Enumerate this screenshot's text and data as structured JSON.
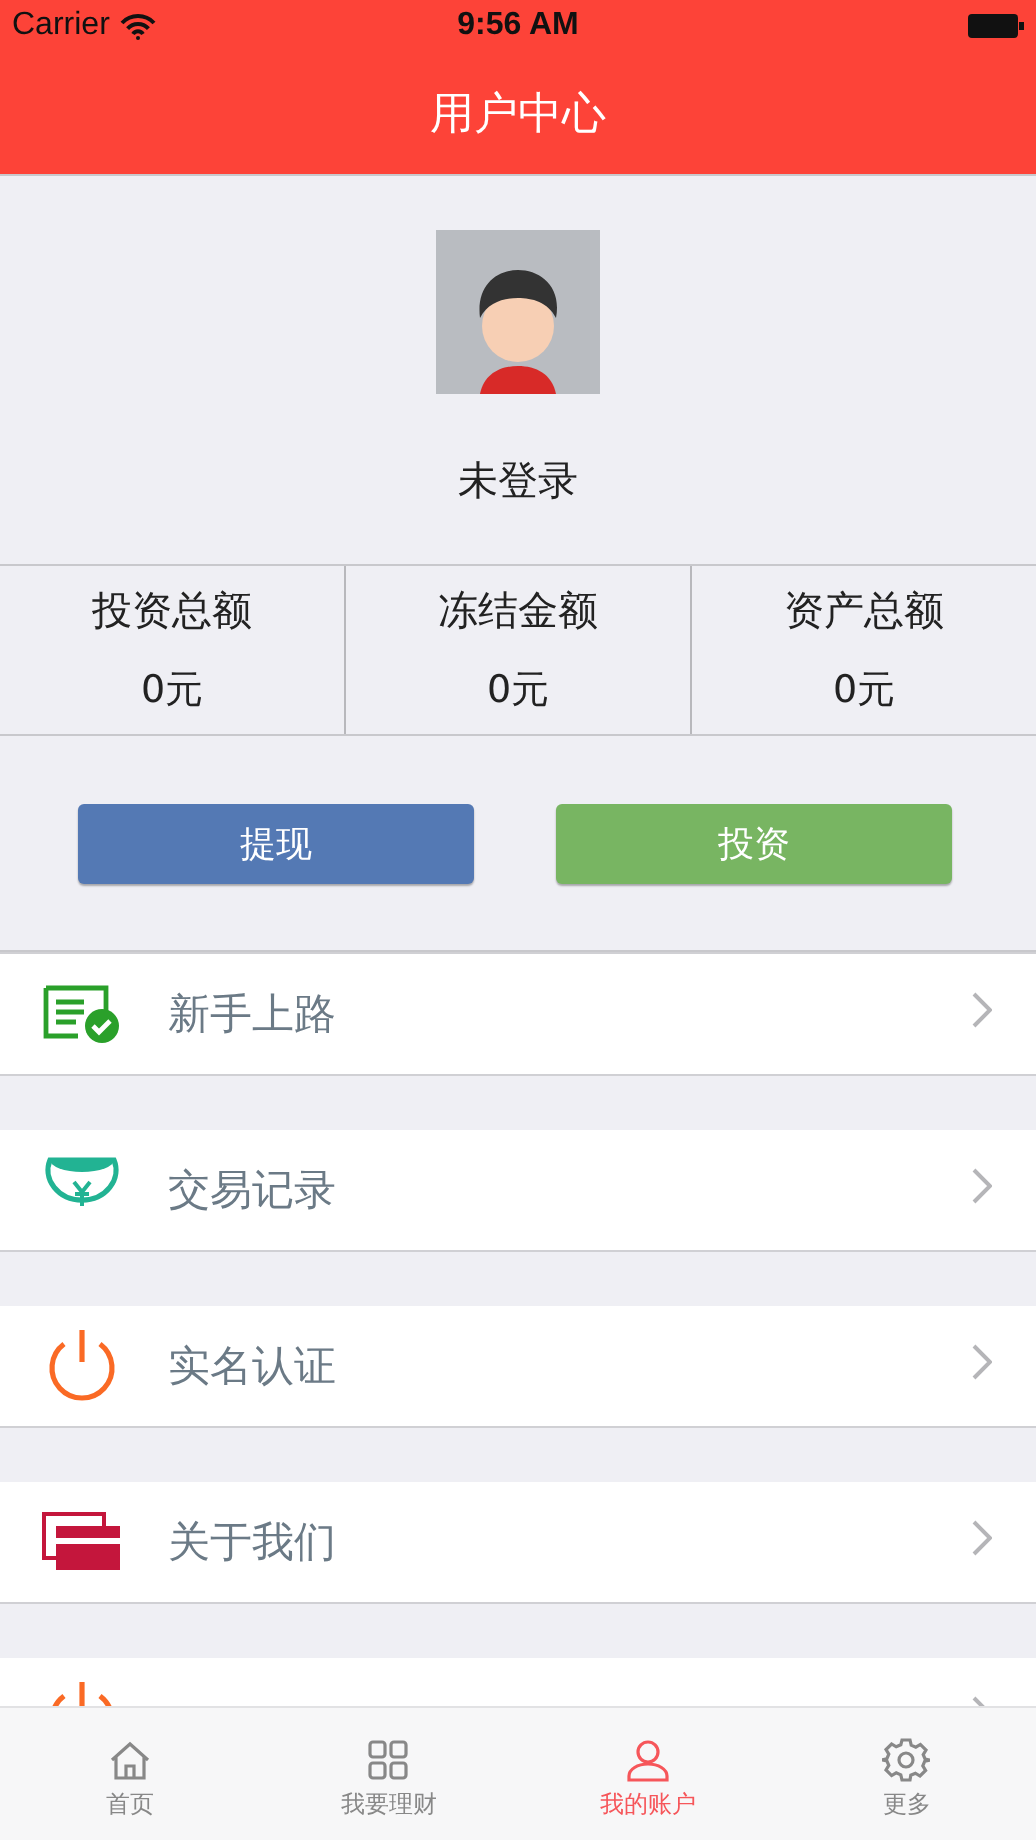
{
  "status_bar": {
    "carrier": "Carrier",
    "time": "9:56 AM"
  },
  "nav": {
    "title": "用户中心"
  },
  "profile": {
    "name": "未登录"
  },
  "stats": [
    {
      "label": "投资总额",
      "value": "0元"
    },
    {
      "label": "冻结金额",
      "value": "0元"
    },
    {
      "label": "资产总额",
      "value": "0元"
    }
  ],
  "actions": [
    {
      "label": "提现",
      "color": "#5479b4"
    },
    {
      "label": "投资",
      "color": "#78b562"
    }
  ],
  "menu": [
    {
      "kind": "guide",
      "label": "新手上路"
    },
    {
      "kind": "record",
      "label": "交易记录"
    },
    {
      "kind": "verify",
      "label": "实名认证"
    },
    {
      "kind": "about",
      "label": "关于我们"
    },
    {
      "kind": "logout"
    }
  ],
  "tabs": [
    {
      "kind": "home",
      "label": "首页",
      "selected": false
    },
    {
      "kind": "grid",
      "label": "我要理财",
      "selected": false
    },
    {
      "kind": "user",
      "label": "我的账户",
      "selected": true
    },
    {
      "kind": "gear",
      "label": "更多",
      "selected": false
    }
  ]
}
